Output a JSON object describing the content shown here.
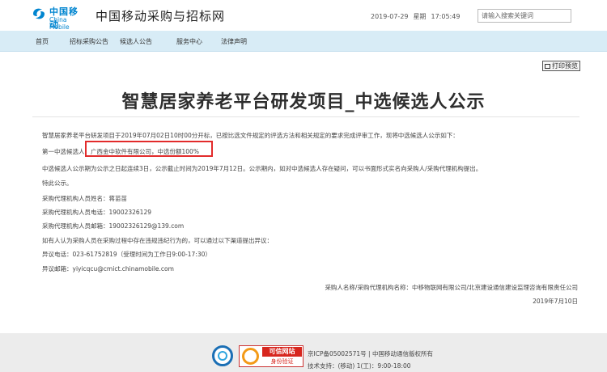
{
  "header": {
    "logo_cn": "中国移动",
    "logo_en": "China Mobile",
    "site_title": "中国移动采购与招标网",
    "date": "2019-07-29",
    "weekday": "星期",
    "time": "17:05:49",
    "search_placeholder": "请输入搜索关键词"
  },
  "nav": {
    "items": [
      "首页",
      "招标采购公告",
      "候选人公告",
      "服务中心",
      "法律声明"
    ]
  },
  "toolbar": {
    "print_label": "打印预览"
  },
  "notice": {
    "title": "智慧居家养老平台研发项目_中选候选人公示",
    "intro": "智慧居家养老平台研发项目于2019年07月02日10时00分开标，已按比选文件规定的评选方法和相关规定的要求完成评审工作，现将中选候选人公示如下：",
    "rank_label": "第一中选候选人：",
    "winner": "广西金中软件有限公司，中选份额100%",
    "lines": [
      "中选候选人公示期为公示之日起连续3日，公示截止时间为2019年7月12日。公示期内，如对中选候选人存在疑问，可以书面形式实名向采购人/采购代理机构提出。",
      "特此公示。",
      "采购代理机构人员姓名：蒋苗苗",
      "采购代理机构人员电话：19002326129",
      "采购代理机构人员邮箱：19002326129@139.com",
      "如有人认为采购人员在采购过程中存在违规违纪行为的，可以通过以下渠道提出异议：",
      "异议电话：023-61752819（受理时间为工作日9:00-17:30）",
      "异议邮箱：yiyicqcu@cmict.chinamobile.com"
    ],
    "signature": "采购人名称/采购代理机构名称：中移物联网有限公司/北京建设通信建设监理咨询有限责任公司",
    "sign_date": "2019年7月10日"
  },
  "footer": {
    "badge_text1": "可信网站",
    "badge_text2": "身份验证",
    "line1": "京ICP备05002571号 | 中国移动通信版权所有",
    "line2": "技术支持：(移动) 1(工)：9:00-18:00"
  },
  "colors": {
    "nav_bg": "#d8ecf6",
    "brand_blue": "#0085d0",
    "highlight_red": "#e22b2b",
    "footer_bg": "#ececec"
  }
}
